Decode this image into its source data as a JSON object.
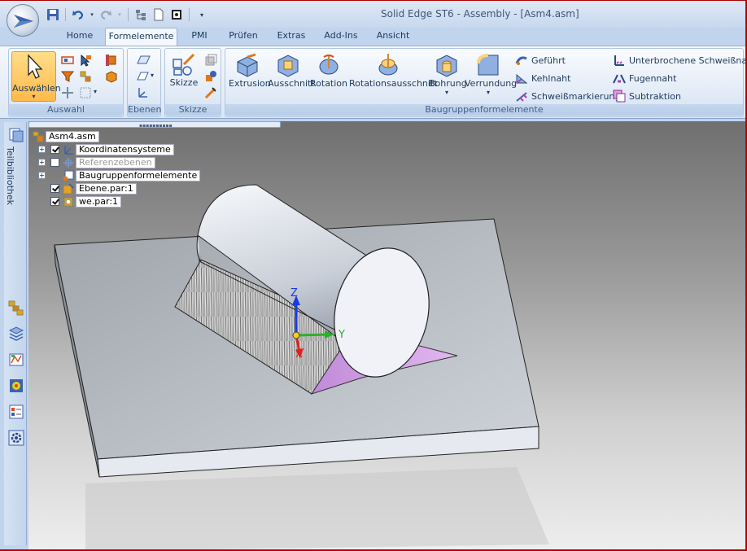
{
  "window": {
    "title": "Solid Edge ST6 - Assembly - [Asm4.asm]"
  },
  "tabs": [
    "Home",
    "Formelemente",
    "PMI",
    "Prüfen",
    "Extras",
    "Add-Ins",
    "Ansicht"
  ],
  "active_tab": "Formelemente",
  "ribbon": {
    "auswahl": {
      "label": "Auswahl",
      "select_button": "Auswählen"
    },
    "ebenen": {
      "label": "Ebenen"
    },
    "skizze": {
      "label": "Skizze",
      "button": "Skizze"
    },
    "baugruppe": {
      "label": "Baugruppenformelemente",
      "big_buttons": [
        "Extrusion",
        "Ausschnitt",
        "Rotation",
        "Rotationsausschnitt",
        "Bohrung",
        "Verrundung"
      ],
      "col1": [
        "Geführt",
        "Kehlnaht",
        "Schweißmarkierung"
      ],
      "col2": [
        "Unterbrochene Schweißnaht",
        "Fugennaht",
        "Subtraktion"
      ]
    }
  },
  "left_bar": {
    "label": "Teilbibliothek"
  },
  "tree": {
    "root": "Asm4.asm",
    "items": [
      {
        "label": "Koordinatensysteme",
        "checked": true,
        "expandable": true,
        "dim": false
      },
      {
        "label": "Referenzebenen",
        "checked": false,
        "expandable": true,
        "dim": true
      },
      {
        "label": "Baugruppenformelemente",
        "checked": null,
        "expandable": true,
        "dim": false
      },
      {
        "label": "Ebene.par:1",
        "checked": true,
        "expandable": false,
        "dim": false
      },
      {
        "label": "we.par:1",
        "checked": true,
        "expandable": false,
        "dim": false
      }
    ]
  },
  "triad": {
    "x": "X",
    "y": "Y",
    "z": "Z"
  },
  "colors": {
    "accent": "#ffba4a",
    "ribbon": "#dce7f5",
    "frame": "#b00000"
  }
}
